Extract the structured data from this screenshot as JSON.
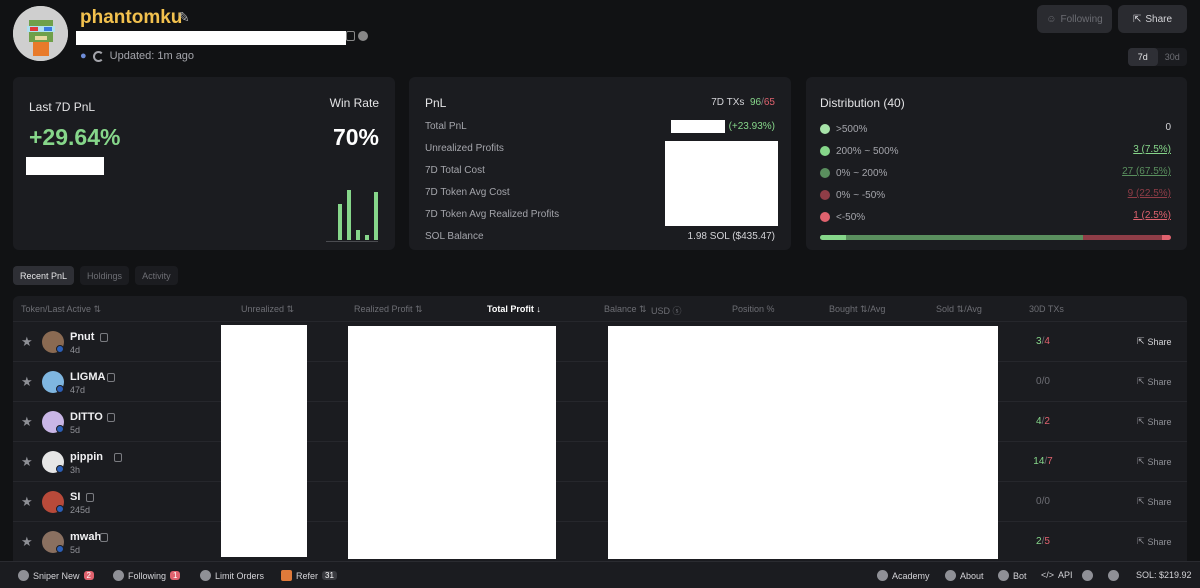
{
  "header": {
    "username": "phantomku",
    "updated": "Updated: 1m ago",
    "following_label": "Following",
    "share_label": "Share",
    "ranges": [
      "7d",
      "30d"
    ],
    "active_range": "7d"
  },
  "pnl_card": {
    "label": "Last 7D PnL",
    "value": "+29.64%",
    "winrate_label": "Win Rate",
    "winrate_value": "70%",
    "spark_values": [
      0.72,
      1.0,
      0.2,
      0.1,
      0.95
    ]
  },
  "stats_card": {
    "title": "PnL",
    "txs_label": "7D TXs",
    "txs_wins": "96",
    "txs_losses": "65",
    "rows": [
      {
        "label": "Total PnL",
        "value": "(+23.93%)"
      },
      {
        "label": "Unrealized Profits",
        "value": ""
      },
      {
        "label": "7D Total Cost",
        "value": ""
      },
      {
        "label": "7D Token Avg Cost",
        "value": ""
      },
      {
        "label": "7D Token Avg Realized Profits",
        "value": ""
      },
      {
        "label": "SOL Balance",
        "value": "1.98 SOL ($435.47)"
      }
    ]
  },
  "distribution": {
    "title": "Distribution (40)",
    "rows": [
      {
        "label": ">500%",
        "value": "0",
        "color": "#a7e3a9",
        "val_color": "#d4d4d8",
        "underline": false
      },
      {
        "label": "200% ~ 500%",
        "value": "3 (7.5%)",
        "color": "#86d68a",
        "val_color": "#86d68a",
        "underline": true
      },
      {
        "label": "0% ~ 200%",
        "value": "27 (67.5%)",
        "color": "#5a8f5e",
        "val_color": "#5a8f5e",
        "underline": true
      },
      {
        "label": "0% ~ -50%",
        "value": "9 (22.5%)",
        "color": "#8f3d47",
        "val_color": "#8f3d47",
        "underline": true
      },
      {
        "label": "<-50%",
        "value": "1 (2.5%)",
        "color": "#e0626e",
        "val_color": "#e0626e",
        "underline": true
      }
    ],
    "bar": [
      {
        "share": 0.075,
        "color": "#86d68a"
      },
      {
        "share": 0.675,
        "color": "#5a8f5e"
      },
      {
        "share": 0.225,
        "color": "#8f3d47"
      },
      {
        "share": 0.025,
        "color": "#e0626e"
      }
    ]
  },
  "tabs": [
    "Recent PnL",
    "Holdings",
    "Activity"
  ],
  "table": {
    "headers": {
      "token": "Token/Last Active",
      "unrealized": "Unrealized",
      "realized": "Realized Profit",
      "total": "Total Profit",
      "balance": "Balance",
      "usd": "USD",
      "position": "Position %",
      "bought": "Bought",
      "bought_avg": "/Avg",
      "sold": "Sold",
      "sold_avg": "/Avg",
      "txs": "30D TXs"
    },
    "rows": [
      {
        "name": "Pnut",
        "age": "4d",
        "wins": "3",
        "losses": "4",
        "share": "Share",
        "av": "#8a6a52"
      },
      {
        "name": "LIGMA",
        "age": "47d",
        "wins": "0",
        "losses": "0",
        "share": "Share",
        "av": "#7fb6e0"
      },
      {
        "name": "DITTO",
        "age": "5d",
        "wins": "4",
        "losses": "2",
        "share": "Share",
        "av": "#c9b6e6"
      },
      {
        "name": "pippin",
        "age": "3h",
        "wins": "14",
        "losses": "7",
        "share": "Share",
        "av": "#e6e6e6"
      },
      {
        "name": "SI",
        "age": "245d",
        "wins": "0",
        "losses": "0",
        "share": "Share",
        "av": "#b84a3a"
      },
      {
        "name": "mwah",
        "age": "5d",
        "wins": "2",
        "losses": "5",
        "share": "Share",
        "av": "#8a7060"
      }
    ]
  },
  "footer": {
    "sniper": "Sniper New",
    "sniper_count": "2",
    "following": "Following",
    "following_count": "1",
    "limit": "Limit Orders",
    "refer": "Refer",
    "refer_count": "31",
    "academy": "Academy",
    "about": "About",
    "bot": "Bot",
    "api": "API",
    "sol": "SOL: $219.92"
  }
}
